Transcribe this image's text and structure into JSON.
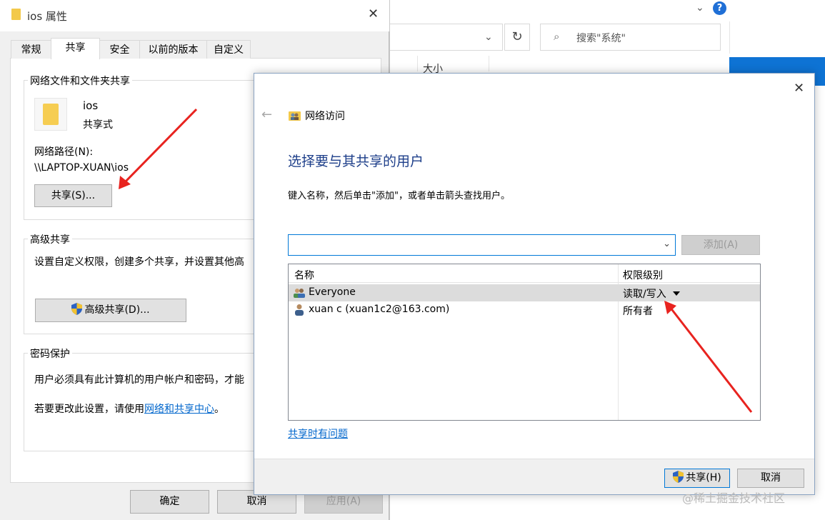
{
  "explorer": {
    "search_placeholder": "搜索\"系统\"",
    "column_size": "大小",
    "help_icon": "?"
  },
  "properties": {
    "title": "ios 属性",
    "tabs": [
      "常规",
      "共享",
      "安全",
      "以前的版本",
      "自定义"
    ],
    "active_tab": "共享",
    "network_sharing": {
      "group_label": "网络文件和文件夹共享",
      "name": "ios",
      "state": "共享式",
      "path_label": "网络路径(N):",
      "path": "\\\\LAPTOP-XUAN\\ios",
      "share_button": "共享(S)..."
    },
    "advanced": {
      "group_label": "高级共享",
      "desc": "设置自定义权限，创建多个共享，并设置其他高",
      "button": "高级共享(D)..."
    },
    "password": {
      "group_label": "密码保护",
      "desc1": "用户必须具有此计算机的用户帐户和密码，才能",
      "desc2_prefix": "若要更改此设置，请使用",
      "desc2_link": "网络和共享中心",
      "desc2_suffix": "。"
    },
    "buttons": {
      "ok": "确定",
      "cancel": "取消",
      "apply": "应用(A)"
    }
  },
  "share_dialog": {
    "title": "网络访问",
    "heading": "选择要与其共享的用户",
    "instruction": "键入名称，然后单击\"添加\"，或者单击箭头查找用户。",
    "add_button": "添加(A)",
    "columns": {
      "name": "名称",
      "permission": "权限级别"
    },
    "rows": [
      {
        "name": "Everyone",
        "permission": "读取/写入",
        "selected": true
      },
      {
        "name": "xuan c (xuan1c2@163.com)",
        "permission": "所有者",
        "selected": false
      }
    ],
    "help_link": "共享时有问题",
    "share_button": "共享(H)",
    "cancel_button": "取消"
  },
  "watermark": "@稀土掘金技术社区",
  "colors": {
    "accent": "#0078d7",
    "heading": "#1e3f8a",
    "link": "#0066cc",
    "annotation_arrow": "#e8231f"
  }
}
